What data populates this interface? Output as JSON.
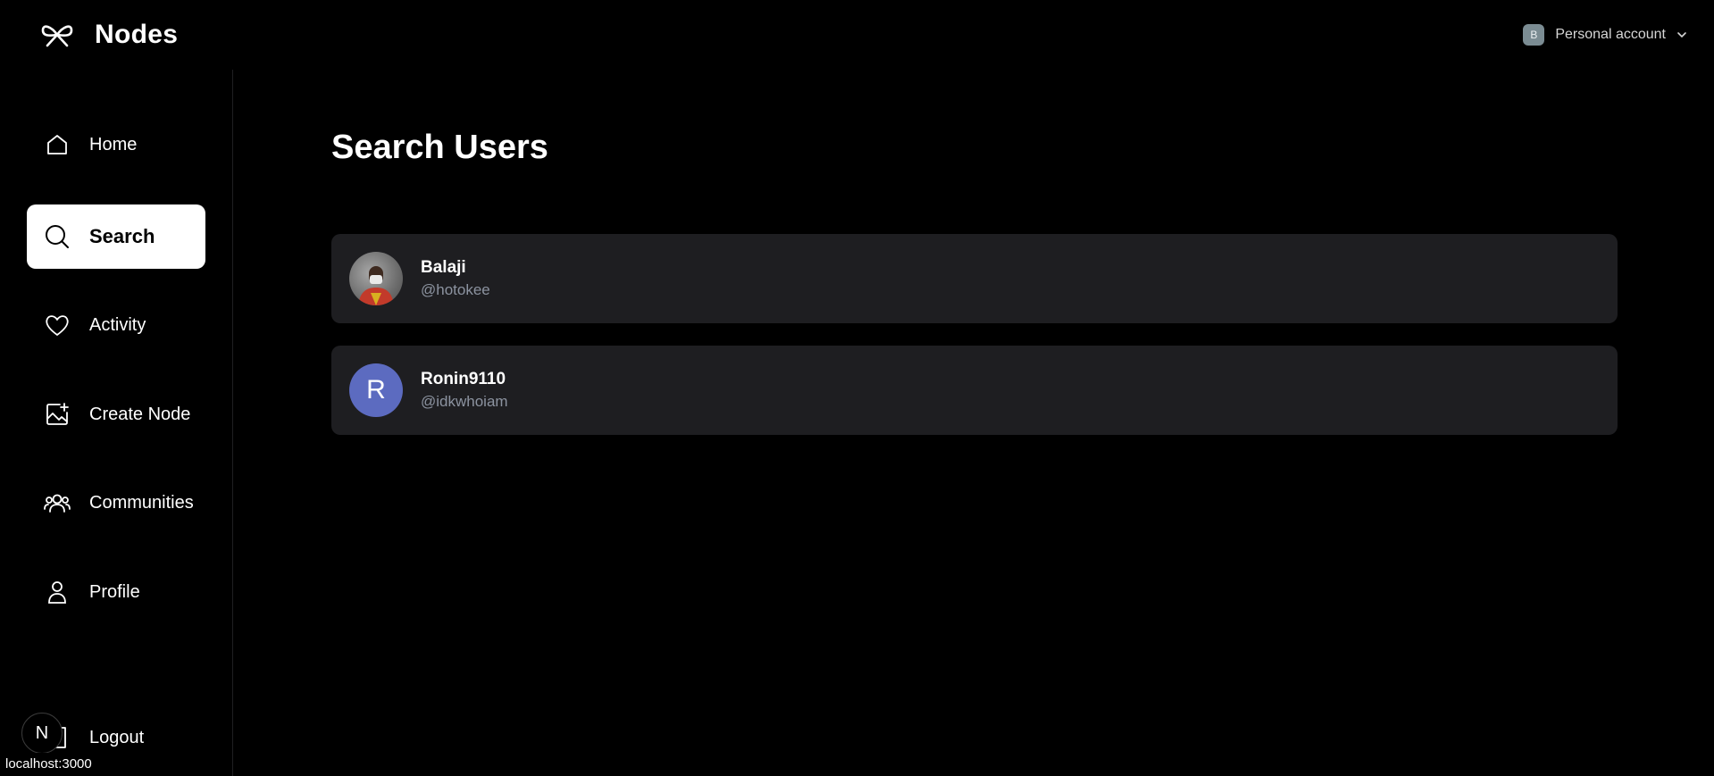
{
  "app": {
    "name": "Nodes",
    "logo_icon": "ribbon-knot-logo"
  },
  "account": {
    "avatar_initial": "B",
    "label": "Personal account",
    "menu_icon": "chevron-down-icon"
  },
  "sidebar": {
    "items": [
      {
        "label": "Home",
        "icon": "home-icon",
        "active": false
      },
      {
        "label": "Search",
        "icon": "search-icon",
        "active": true
      },
      {
        "label": "Activity",
        "icon": "heart-icon",
        "active": false
      },
      {
        "label": "Create Node",
        "icon": "image-plus-icon",
        "active": false
      },
      {
        "label": "Communities",
        "icon": "users-icon",
        "active": false
      },
      {
        "label": "Profile",
        "icon": "user-icon",
        "active": false
      }
    ],
    "logout_label": "Logout",
    "logout_icon": "logout-icon"
  },
  "main": {
    "title": "Search Users",
    "users": [
      {
        "name": "Balaji",
        "handle": "@hotokee",
        "avatar": "photo"
      },
      {
        "name": "Ronin9110",
        "handle": "@idkwhoiam",
        "avatar": "letter",
        "avatar_initial": "R"
      }
    ]
  },
  "overlay": {
    "next_badge": "N",
    "status_url": "localhost:3000"
  },
  "colors": {
    "background": "#000000",
    "card": "#1e1e21",
    "active_nav": "#ffffff",
    "handle_text": "#8c93a0",
    "letter_avatar": "#5c6bc0"
  }
}
